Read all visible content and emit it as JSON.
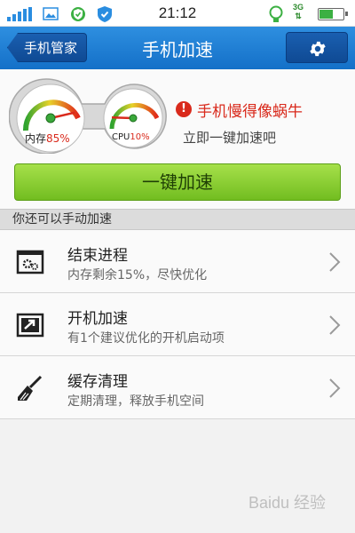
{
  "status_bar": {
    "time": "21:12",
    "network_label": "3G"
  },
  "header": {
    "back_label": "手机管家",
    "title": "手机加速"
  },
  "gauges": {
    "memory_label": "内存",
    "memory_value": "85%",
    "memory_fraction": 0.85,
    "cpu_label": "CPU",
    "cpu_value": "10%",
    "cpu_fraction": 0.1
  },
  "alert": {
    "icon_text": "!",
    "title": "手机慢得像蜗牛",
    "subtitle": "立即一键加速吧"
  },
  "boost_button_label": "一键加速",
  "section_header": "你还可以手动加速",
  "items": [
    {
      "icon": "process-window-icon",
      "title": "结束进程",
      "desc": "内存剩余15%，尽快优化"
    },
    {
      "icon": "startup-boot-icon",
      "title": "开机加速",
      "desc": "有1个建议优化的开机启动项"
    },
    {
      "icon": "broom-icon",
      "title": "缓存清理",
      "desc": "定期清理，释放手机空间"
    }
  ],
  "watermark_text": "Baidu 经验",
  "colors": {
    "header_blue": "#1470c8",
    "alert_red": "#d92a1c",
    "boost_green": "#8fd236"
  }
}
